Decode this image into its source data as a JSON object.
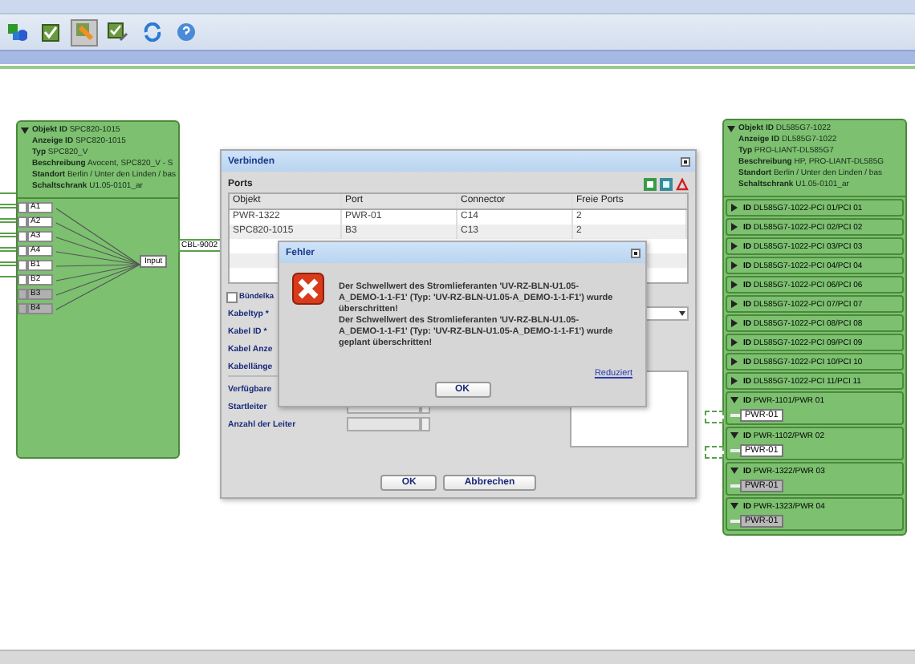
{
  "toolbar": [
    {
      "kind": "network",
      "selected": false
    },
    {
      "kind": "check",
      "selected": false
    },
    {
      "kind": "connect",
      "selected": true
    },
    {
      "kind": "check-edit",
      "selected": false
    },
    {
      "kind": "refresh",
      "selected": false
    },
    {
      "kind": "help",
      "selected": false
    }
  ],
  "left_node": {
    "expanded": true,
    "fields": [
      {
        "label": "Objekt ID",
        "value": "SPC820-1015"
      },
      {
        "label": "Anzeige ID",
        "value": "SPC820-1015"
      },
      {
        "label": "Typ",
        "value": "SPC820_V"
      },
      {
        "label": "Beschreibung",
        "value": "Avocent, SPC820_V - S"
      },
      {
        "label": "Standort",
        "value": "Berlin / Unter den Linden / bas"
      },
      {
        "label": "Schaltschrank",
        "value": "U1.05-0101_ar"
      }
    ],
    "ports": [
      {
        "name": "A1",
        "connected": true
      },
      {
        "name": "A2",
        "connected": true
      },
      {
        "name": "A3",
        "connected": true
      },
      {
        "name": "A4",
        "connected": true
      },
      {
        "name": "B1",
        "connected": true
      },
      {
        "name": "B2",
        "connected": true
      },
      {
        "name": "B3",
        "connected": false
      },
      {
        "name": "B4",
        "connected": false
      }
    ],
    "input_label": "Input",
    "cable": "CBL-9002"
  },
  "right_node": {
    "expanded": true,
    "fields": [
      {
        "label": "Objekt ID",
        "value": "DL585G7-1022"
      },
      {
        "label": "Anzeige ID",
        "value": "DL585G7-1022"
      },
      {
        "label": "Typ",
        "value": "PRO-LIANT-DL585G7"
      },
      {
        "label": "Beschreibung",
        "value": "HP, PRO-LIANT-DL585G"
      },
      {
        "label": "Standort",
        "value": "Berlin / Unter den Linden / bas"
      },
      {
        "label": "Schaltschrank",
        "value": "U1.05-0101_ar"
      }
    ],
    "slots": [
      {
        "label": "ID",
        "value": "DL585G7-1022-PCI 01/PCI 01",
        "expanded": false
      },
      {
        "label": "ID",
        "value": "DL585G7-1022-PCI 02/PCI 02",
        "expanded": false
      },
      {
        "label": "ID",
        "value": "DL585G7-1022-PCI 03/PCI 03",
        "expanded": false
      },
      {
        "label": "ID",
        "value": "DL585G7-1022-PCI 04/PCI 04",
        "expanded": false
      },
      {
        "label": "ID",
        "value": "DL585G7-1022-PCI 06/PCI 06",
        "expanded": false
      },
      {
        "label": "ID",
        "value": "DL585G7-1022-PCI 07/PCI 07",
        "expanded": false
      },
      {
        "label": "ID",
        "value": "DL585G7-1022-PCI 08/PCI 08",
        "expanded": false
      },
      {
        "label": "ID",
        "value": "DL585G7-1022-PCI 09/PCI 09",
        "expanded": false
      },
      {
        "label": "ID",
        "value": "DL585G7-1022-PCI 10/PCI 10",
        "expanded": false
      },
      {
        "label": "ID",
        "value": "DL585G7-1022-PCI 11/PCI 11",
        "expanded": false
      },
      {
        "label": "ID",
        "value": "PWR-1101/PWR 01",
        "expanded": true,
        "ports": [
          {
            "name": "PWR-01",
            "connected": true
          }
        ]
      },
      {
        "label": "ID",
        "value": "PWR-1102/PWR 02",
        "expanded": true,
        "ports": [
          {
            "name": "PWR-01",
            "connected": true
          }
        ]
      },
      {
        "label": "ID",
        "value": "PWR-1322/PWR 03",
        "expanded": true,
        "ports": [
          {
            "name": "PWR-01",
            "connected": false
          }
        ]
      },
      {
        "label": "ID",
        "value": "PWR-1323/PWR 04",
        "expanded": true,
        "ports": [
          {
            "name": "PWR-01",
            "connected": false
          }
        ]
      }
    ]
  },
  "connect_dialog": {
    "title": "Verbinden",
    "section": "Ports",
    "columns": [
      "Objekt",
      "Port",
      "Connector",
      "Freie Ports"
    ],
    "rows": [
      [
        "PWR-1322",
        "PWR-01",
        "C14",
        "2"
      ],
      [
        "SPC820-1015",
        "B3",
        "C13",
        "2"
      ]
    ],
    "bundle": {
      "label": "Bündelka",
      "checked": false
    },
    "fields": [
      {
        "label": "Kabeltyp *"
      },
      {
        "label": "Kabel ID *"
      },
      {
        "label": "Kabel Anze"
      },
      {
        "label": "Kabellänge"
      }
    ],
    "section2": "Verfügbare",
    "spin_fields": [
      {
        "label": "Startleiter",
        "disabled": true
      },
      {
        "label": "Anzahl der Leiter",
        "disabled": true
      }
    ],
    "buttons": [
      "OK",
      "Abbrechen"
    ]
  },
  "error_dialog": {
    "title": "Fehler",
    "message": [
      "Der Schwellwert des Stromlieferanten 'UV-RZ-BLN-U1.05-A_DEMO-1-1-F1' (Typ: 'UV-RZ-BLN-U1.05-A_DEMO-1-1-F1') wurde überschritten!",
      "Der Schwellwert des Stromlieferanten 'UV-RZ-BLN-U1.05-A_DEMO-1-1-F1' (Typ: 'UV-RZ-BLN-U1.05-A_DEMO-1-1-F1') wurde geplant überschritten!"
    ],
    "link": "Reduziert",
    "button": "OK"
  }
}
